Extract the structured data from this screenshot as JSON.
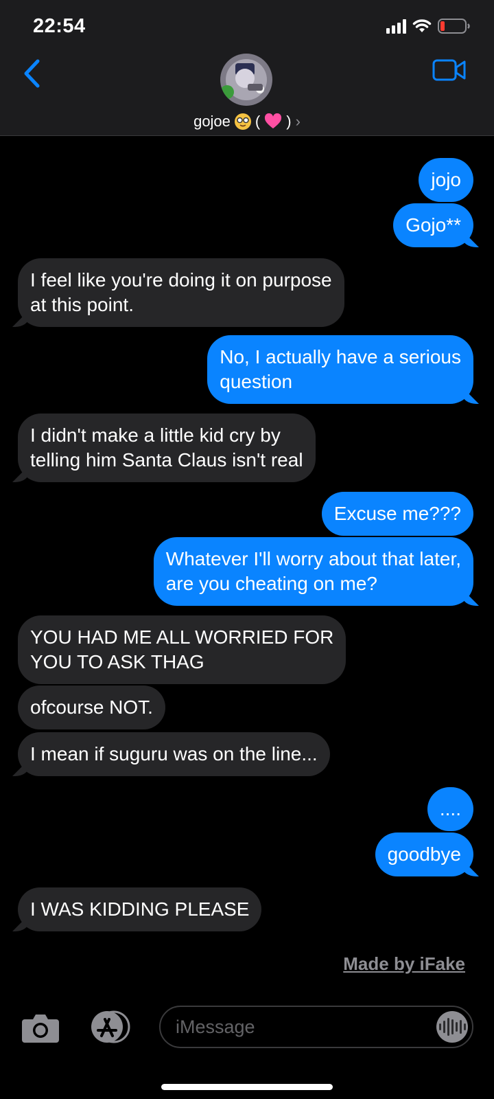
{
  "status": {
    "time": "22:54"
  },
  "header": {
    "contact_name": "gojoe",
    "contact_suffix_open": "(",
    "contact_suffix_close": ")",
    "back_icon": "chevron-left-icon",
    "video_icon": "video-camera-icon"
  },
  "messages": [
    {
      "side": "sent",
      "text": "jojo"
    },
    {
      "side": "sent",
      "text": "Gojo**"
    },
    {
      "side": "recv",
      "text": "I feel like you're doing it on purpose\nat this point."
    },
    {
      "side": "sent",
      "text": "No, I actually have a serious\nquestion"
    },
    {
      "side": "recv",
      "text": "I didn't make a little kid cry by\ntelling him Santa Claus isn't real"
    },
    {
      "side": "sent",
      "text": "Excuse me???"
    },
    {
      "side": "sent",
      "text": "Whatever I'll worry about that later,\nare you cheating on me?"
    },
    {
      "side": "recv",
      "text": "YOU HAD ME ALL WORRIED FOR\nYOU TO ASK THAG"
    },
    {
      "side": "recv",
      "text": "ofcourse NOT."
    },
    {
      "side": "recv",
      "text": "I mean if suguru was on the line..."
    },
    {
      "side": "sent",
      "text": "...."
    },
    {
      "side": "sent",
      "text": "goodbye"
    },
    {
      "side": "recv",
      "text": "I WAS KIDDING PLEASE"
    }
  ],
  "watermark": "Made by iFake",
  "composer": {
    "placeholder": "iMessage"
  },
  "colors": {
    "sent_bubble": "#0a84ff",
    "recv_bubble": "#262628",
    "header_bg": "#1c1c1e"
  }
}
